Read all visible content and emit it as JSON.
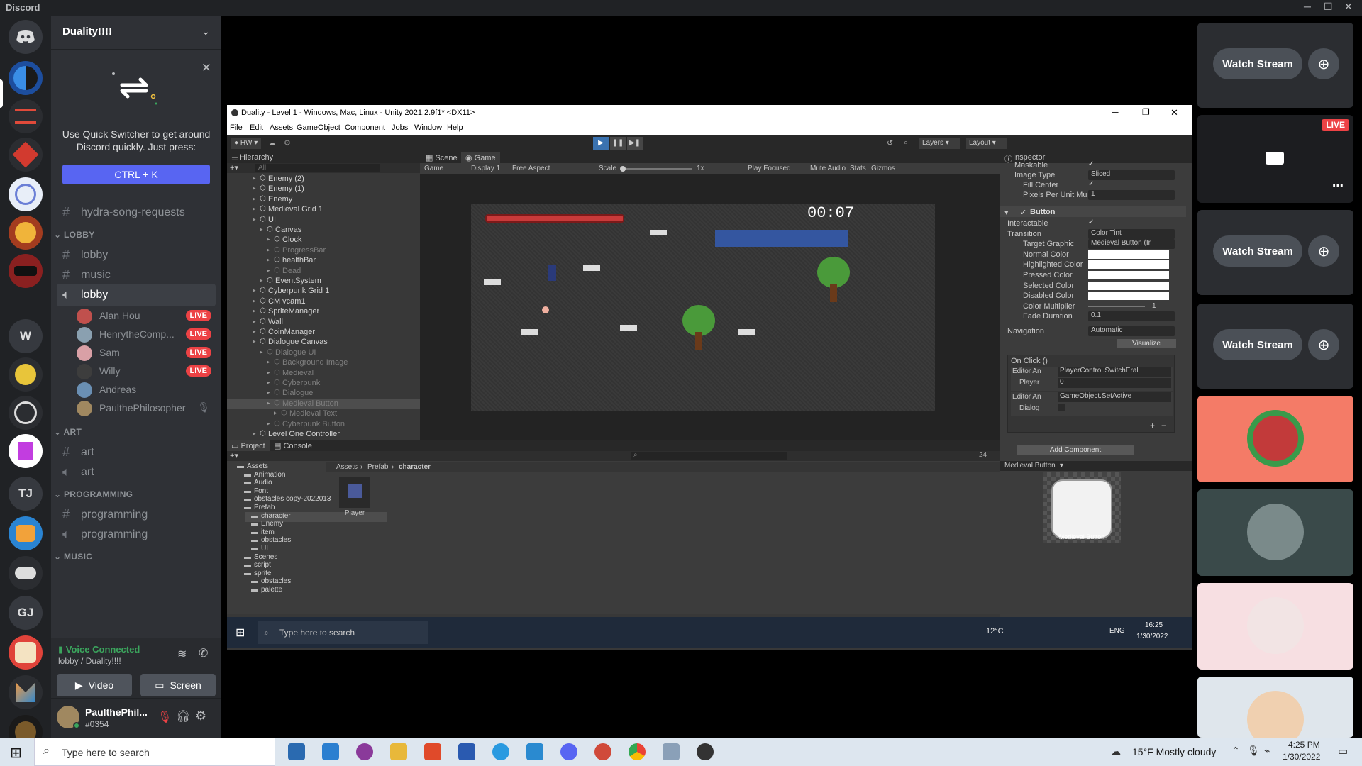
{
  "app": {
    "title": "Discord"
  },
  "server": {
    "name": "Duality!!!!",
    "rail_labels": {
      "w": "W",
      "tj": "TJ",
      "gj": "GJ"
    }
  },
  "quick_switcher": {
    "text": "Use Quick Switcher to get around Discord quickly. Just press:",
    "shortcut": "CTRL + K"
  },
  "channels": {
    "top": "hydra-song-requests",
    "categories": [
      {
        "name": "LOBBY"
      },
      {
        "name": "ART"
      },
      {
        "name": "PROGRAMMING"
      },
      {
        "name": "MUSIC"
      }
    ],
    "lobby_text": "lobby",
    "music_text": "music",
    "lobby_voice": "lobby",
    "voice_users": [
      {
        "name": "Alan Hou",
        "live": "LIVE",
        "color": "#c0504d"
      },
      {
        "name": "HenrytheComp...",
        "live": "LIVE",
        "color": "#8aa0b0"
      },
      {
        "name": "Sam",
        "live": "LIVE",
        "color": "#d9a0a6"
      },
      {
        "name": "Willy",
        "live": "LIVE",
        "color": "#3d3d3d"
      },
      {
        "name": "Andreas",
        "live": "",
        "color": "#6a8fb3"
      },
      {
        "name": "PaulthePhilosopher",
        "live": "",
        "color": "#a08860"
      }
    ],
    "art_text": "art",
    "art_voice": "art",
    "prog_text": "programming",
    "prog_voice": "programming"
  },
  "voice": {
    "status": "Voice Connected",
    "location": "lobby / Duality!!!!",
    "video": "Video",
    "screen": "Screen"
  },
  "user": {
    "name": "PaulthePhil...",
    "tag": "#0354"
  },
  "streams": {
    "watch_label": "Watch Stream",
    "live_badge": "LIVE"
  },
  "unity": {
    "title": "Duality - Level 1 - Windows, Mac, Linux - Unity 2021.2.9f1* <DX11>",
    "menu": [
      "File",
      "Edit",
      "Assets",
      "GameObject",
      "Component",
      "Jobs",
      "Window",
      "Help"
    ],
    "toolbar": {
      "account": "HW",
      "layers": "Layers",
      "layout": "Layout"
    },
    "hierarchy": {
      "title": "Hierarchy",
      "search": "All",
      "rows": [
        {
          "t": "Enemy (2)",
          "i": 1,
          "dim": false
        },
        {
          "t": "Enemy (1)",
          "i": 1,
          "dim": false
        },
        {
          "t": "Enemy",
          "i": 1,
          "dim": false
        },
        {
          "t": "Medieval Grid 1",
          "i": 1,
          "dim": false
        },
        {
          "t": "UI",
          "i": 1,
          "dim": false
        },
        {
          "t": "Canvas",
          "i": 2,
          "dim": false
        },
        {
          "t": "Clock",
          "i": 3,
          "dim": false
        },
        {
          "t": "ProgressBar",
          "i": 3,
          "dim": true
        },
        {
          "t": "healthBar",
          "i": 3,
          "dim": false
        },
        {
          "t": "Dead",
          "i": 3,
          "dim": true
        },
        {
          "t": "EventSystem",
          "i": 2,
          "dim": false
        },
        {
          "t": "Cyberpunk Grid 1",
          "i": 1,
          "dim": false
        },
        {
          "t": "CM vcam1",
          "i": 1,
          "dim": false
        },
        {
          "t": "SpriteManager",
          "i": 1,
          "dim": false
        },
        {
          "t": "Wall",
          "i": 1,
          "dim": false
        },
        {
          "t": "CoinManager",
          "i": 1,
          "dim": false
        },
        {
          "t": "Dialogue Canvas",
          "i": 1,
          "dim": false
        },
        {
          "t": "Dialogue UI",
          "i": 2,
          "dim": true
        },
        {
          "t": "Background Image",
          "i": 3,
          "dim": true
        },
        {
          "t": "Medieval",
          "i": 3,
          "dim": true
        },
        {
          "t": "Cyberpunk",
          "i": 3,
          "dim": true
        },
        {
          "t": "Dialogue",
          "i": 3,
          "dim": true
        },
        {
          "t": "Medieval Button",
          "i": 3,
          "dim": true
        },
        {
          "t": "Medieval Text",
          "i": 4,
          "dim": true
        },
        {
          "t": "Cyberpunk Button",
          "i": 3,
          "dim": true
        },
        {
          "t": "Level One Controller",
          "i": 1,
          "dim": false
        }
      ]
    },
    "scene_tab": "Scene",
    "game_tab": "Game",
    "game_bar": [
      "Game",
      "Display 1",
      "Free Aspect",
      "Scale",
      "1x",
      "Play Focused",
      "Mute Audio",
      "Stats",
      "Gizmos"
    ],
    "timer": "00:07",
    "inspector": {
      "title": "Inspector",
      "rows": [
        {
          "k": "Maskable",
          "v": ""
        },
        {
          "k": "Image Type",
          "v": "Sliced"
        },
        {
          "k": "Fill Center",
          "v": ""
        },
        {
          "k": "Pixels Per Unit Mu",
          "v": "1"
        }
      ],
      "component": "Button",
      "btn_rows": [
        {
          "k": "Interactable",
          "v": ""
        },
        {
          "k": "Transition",
          "v": "Color Tint"
        },
        {
          "k": "Target Graphic",
          "v": "Medieval Button (Ir"
        },
        {
          "k": "Normal Color",
          "v": ""
        },
        {
          "k": "Highlighted Color",
          "v": ""
        },
        {
          "k": "Pressed Color",
          "v": ""
        },
        {
          "k": "Selected Color",
          "v": ""
        },
        {
          "k": "Disabled Color",
          "v": ""
        },
        {
          "k": "Color Multiplier",
          "v": "1"
        },
        {
          "k": "Fade Duration",
          "v": "0.1"
        }
      ],
      "navigation": "Navigation",
      "navigation_val": "Automatic",
      "visualize": "Visualize",
      "onclick": "On Click ()",
      "ev1": {
        "mode": "Editor An",
        "fn": "PlayerControl.SwitchEral",
        "obj": "Player",
        "arg": "0"
      },
      "ev2": {
        "mode": "Editor An",
        "fn": "GameObject.SetActive",
        "obj": "Dialog"
      },
      "add_component": "Add Component",
      "preview": "Medieval Button",
      "preview_img": "Medieval Button"
    },
    "project": {
      "tab": "Project",
      "console": "Console",
      "count": "24",
      "breadcrumb": [
        "Assets",
        "Prefab",
        "character"
      ],
      "tree": [
        {
          "t": "Assets",
          "i": 0
        },
        {
          "t": "Animation",
          "i": 1
        },
        {
          "t": "Audio",
          "i": 1
        },
        {
          "t": "Font",
          "i": 1
        },
        {
          "t": "obstacles copy-2022013",
          "i": 1
        },
        {
          "t": "Prefab",
          "i": 1
        },
        {
          "t": "character",
          "i": 2
        },
        {
          "t": "Enemy",
          "i": 2
        },
        {
          "t": "item",
          "i": 2
        },
        {
          "t": "obstacles",
          "i": 2
        },
        {
          "t": "UI",
          "i": 2
        },
        {
          "t": "Scenes",
          "i": 1
        },
        {
          "t": "script",
          "i": 1
        },
        {
          "t": "sprite",
          "i": 1
        },
        {
          "t": "obstacles",
          "i": 2
        },
        {
          "t": "palette",
          "i": 2
        }
      ],
      "asset": "Player"
    },
    "taskbar": {
      "search": "Type here to search",
      "weather": "12°C",
      "lang": "ENG",
      "time": "16:25",
      "date": "1/30/2022"
    }
  },
  "taskbar": {
    "search": "Type here to search",
    "weather": "15°F  Mostly cloudy",
    "time": "4:25 PM",
    "date": "1/30/2022"
  }
}
